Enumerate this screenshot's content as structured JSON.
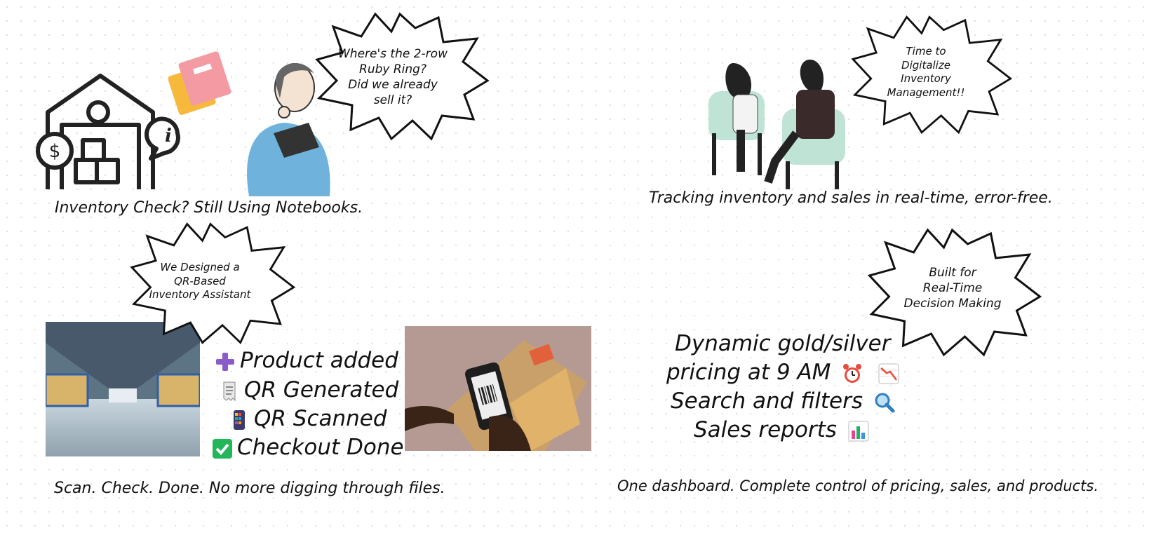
{
  "top_left": {
    "bubble_lines": [
      "Where's the 2-row",
      "Ruby Ring?",
      "Did we already",
      "sell it?"
    ],
    "caption": "Inventory Check? Still Using Notebooks."
  },
  "top_right": {
    "bubble_lines": [
      "Time to",
      "Digitalize",
      "Inventory",
      "Management!!"
    ],
    "caption": "Tracking inventory and sales in real-time, error-free."
  },
  "bottom_left": {
    "bubble_lines": [
      "We Designed a",
      "QR-Based",
      "Inventory Assistant"
    ],
    "steps": [
      {
        "icon": "plus-icon",
        "label": "Product added"
      },
      {
        "icon": "receipt-icon",
        "label": "QR Generated"
      },
      {
        "icon": "phone-icon",
        "label": "QR Scanned"
      },
      {
        "icon": "checkmark-icon",
        "label": "Checkout Done"
      }
    ],
    "caption": "Scan. Check. Done. No more digging through files."
  },
  "bottom_right": {
    "bubble_lines": [
      "Built for",
      "Real-Time",
      "Decision Making"
    ],
    "features": [
      {
        "label": "Dynamic gold/silver",
        "icons": []
      },
      {
        "label": "pricing at 9 AM",
        "icons": [
          "alarm-clock-icon",
          "chart-decreasing-icon"
        ]
      },
      {
        "label": "Search and filters",
        "icons": [
          "magnifier-icon"
        ]
      },
      {
        "label": "Sales reports",
        "icons": [
          "bar-chart-icon"
        ]
      }
    ],
    "caption": "One dashboard. Complete control of pricing, sales, and products."
  },
  "colors": {
    "chair": "#bfe4d6",
    "shirt": "#6fb3dd",
    "notebook_pink": "#f49aa3",
    "notebook_yellow": "#f6b93b",
    "plus": "#8a5cc9",
    "check": "#22b55a"
  }
}
